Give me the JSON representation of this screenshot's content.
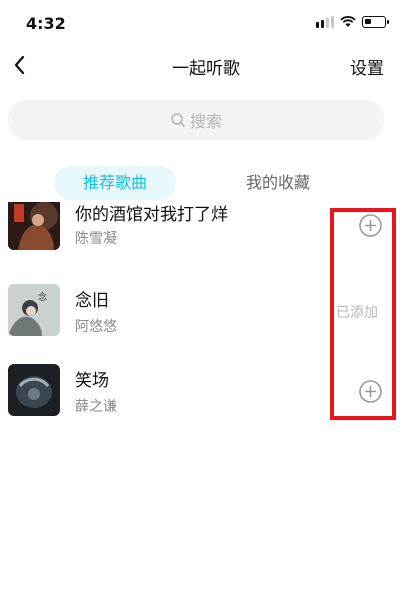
{
  "status_bar": {
    "time": "4:32"
  },
  "nav": {
    "title": "一起听歌",
    "settings_label": "设置"
  },
  "search": {
    "placeholder": "搜索"
  },
  "tabs": [
    {
      "label": "推荐歌曲",
      "active": true
    },
    {
      "label": "我的收藏",
      "active": false
    }
  ],
  "songs": [
    {
      "title": "你的酒馆对我打了烊",
      "artist": "陈雪凝",
      "action": "add"
    },
    {
      "title": "念旧",
      "artist": "阿悠悠",
      "action": "added",
      "action_label": "已添加"
    },
    {
      "title": "笑场",
      "artist": "薛之谦",
      "action": "add"
    }
  ],
  "colors": {
    "accent": "#16c1d6",
    "tab_bg": "#e7f8fa",
    "highlight": "#e8161a"
  }
}
